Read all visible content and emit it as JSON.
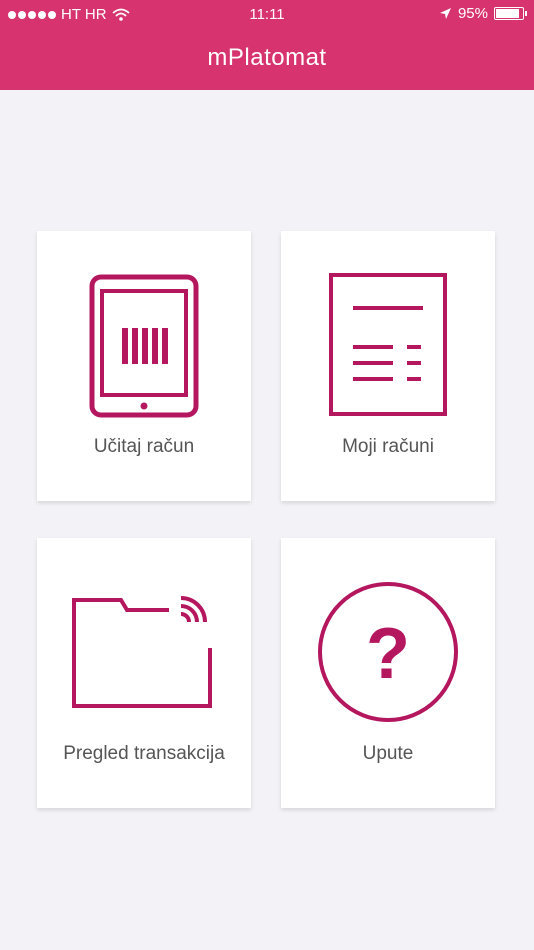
{
  "status_bar": {
    "carrier": "HT HR",
    "time": "11:11",
    "battery": "95%",
    "battery_level": 0.95
  },
  "header": {
    "title": "mPlatomat"
  },
  "tiles": [
    {
      "label": "Učitaj račun",
      "icon": "tablet-barcode-icon"
    },
    {
      "label": "Moji računi",
      "icon": "document-list-icon"
    },
    {
      "label": "Pregled transakcija",
      "icon": "folder-wireless-icon"
    },
    {
      "label": "Upute",
      "icon": "question-circle-icon"
    }
  ],
  "colors": {
    "accent": "#d6336f",
    "icon": "#b5175f",
    "background": "#f3f3f7"
  }
}
